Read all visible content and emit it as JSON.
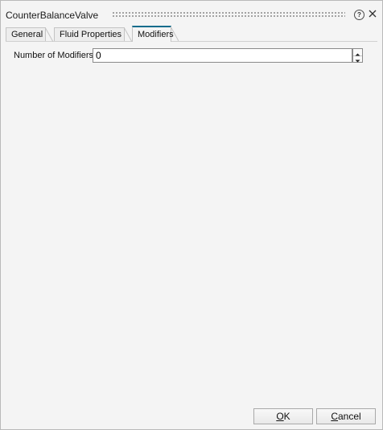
{
  "window": {
    "title": "CounterBalanceValve",
    "help_symbol": "?"
  },
  "tabs": [
    {
      "label": "General",
      "active": false
    },
    {
      "label": "Fluid Properties",
      "active": false
    },
    {
      "label": "Modifiers",
      "active": true
    }
  ],
  "modifiers": {
    "count_label": "Number of Modifiers",
    "count_value": "0"
  },
  "footer": {
    "ok_first": "O",
    "ok_rest": "K",
    "cancel_first": "C",
    "cancel_rest": "ancel"
  },
  "colors": {
    "active_tab_accent": "#0e6c8c",
    "background": "#f4f4f4"
  }
}
